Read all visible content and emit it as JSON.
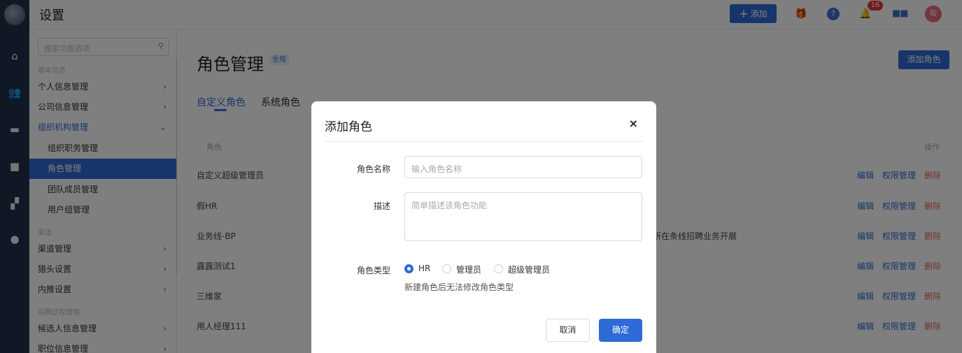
{
  "topbar": {
    "title": "设置",
    "add_label": "添加",
    "notification_count": "16",
    "avatar_text": "船"
  },
  "sidebar": {
    "search_placeholder": "搜索功能选项",
    "group_basic": "基本信息",
    "items": [
      {
        "label": "个人信息管理",
        "chevron": "›"
      },
      {
        "label": "公司信息管理",
        "chevron": "›"
      },
      {
        "label": "组织机构管理",
        "chevron": "⌄"
      },
      {
        "label": "组织职务管理"
      },
      {
        "label": "角色管理"
      },
      {
        "label": "团队成员管理"
      },
      {
        "label": "用户组管理"
      }
    ],
    "group_channel": "渠道",
    "channel_items": [
      {
        "label": "渠道管理",
        "chevron": "›"
      },
      {
        "label": "猎头设置",
        "chevron": "›"
      },
      {
        "label": "内推设置",
        "chevron": "›"
      }
    ],
    "group_process": "招聘过程管理",
    "process_items": [
      {
        "label": "候选人信息管理",
        "chevron": "›"
      },
      {
        "label": "职位信息管理",
        "chevron": "›"
      }
    ]
  },
  "main": {
    "title": "角色管理",
    "scope_badge": "全局",
    "add_role_label": "添加角色",
    "tabs": [
      {
        "label": "自定义角色"
      },
      {
        "label": "系统角色"
      }
    ],
    "col_role": "角色",
    "col_actions": "操作",
    "action_edit": "编辑",
    "action_perm": "权限管理",
    "action_delete": "删除",
    "rows": [
      {
        "name": "自定义超级管理员",
        "desc": ""
      },
      {
        "name": "假HR",
        "desc": ""
      },
      {
        "name": "业务线-BP",
        "desc": "所在条线招聘业务开展"
      },
      {
        "name": "露露测试1",
        "desc": ""
      },
      {
        "name": "三维家",
        "desc": ""
      },
      {
        "name": "用人经理111",
        "desc": ""
      }
    ]
  },
  "modal": {
    "title": "添加角色",
    "close": "×",
    "name_label": "角色名称",
    "name_placeholder": "输入角色名称",
    "desc_label": "描述",
    "desc_placeholder": "简单描述该角色功能",
    "type_label": "角色类型",
    "types": [
      {
        "label": "HR",
        "checked": true
      },
      {
        "label": "管理员",
        "checked": false
      },
      {
        "label": "超级管理员",
        "checked": false
      }
    ],
    "hint": "新建角色后无法修改角色类型",
    "cancel": "取消",
    "ok": "确定"
  },
  "colors": {
    "accent": "#2f6bd6",
    "rail": "#23304b",
    "delete": "#e86a6a"
  }
}
